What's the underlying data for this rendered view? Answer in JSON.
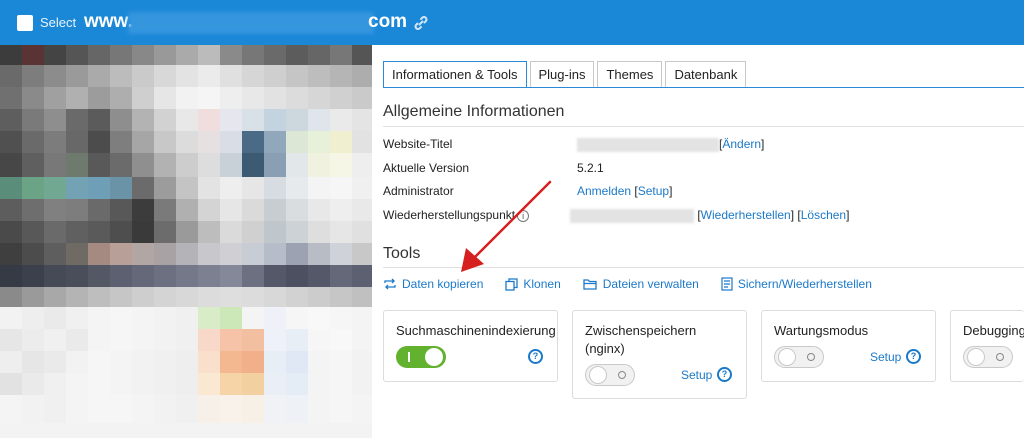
{
  "header": {
    "select_label": "Select",
    "domain_prefix": "www.",
    "domain_suffix": "com",
    "accent": "#1a87d7"
  },
  "tabs": [
    {
      "label": "Informationen & Tools",
      "active": true
    },
    {
      "label": "Plug-ins",
      "active": false
    },
    {
      "label": "Themes",
      "active": false
    },
    {
      "label": "Datenbank",
      "active": false
    }
  ],
  "general": {
    "title": "Allgemeine Informationen",
    "site_title_label": "Website-Titel",
    "site_title_change": "Ändern",
    "version_label": "Aktuelle Version",
    "version_value": "5.2.1",
    "admin_label": "Administrator",
    "admin_login": "Anmelden",
    "admin_setup": "Setup",
    "restore_label": "Wiederherstellungspunkt",
    "restore_action": "Wiederherstellen",
    "delete_action": "Löschen"
  },
  "tools": {
    "title": "Tools",
    "copy_data": "Daten kopieren",
    "clone": "Klonen",
    "manage_files": "Dateien verwalten",
    "backup_restore": "Sichern/Wiederherstellen"
  },
  "cards": {
    "indexing": {
      "title": "Suchmaschinenindexierung",
      "enabled": true
    },
    "caching": {
      "title_line1": "Zwischenspeichern",
      "title_line2": "(nginx)",
      "setup": "Setup",
      "enabled": false
    },
    "maintenance": {
      "title": "Wartungsmodus",
      "setup": "Setup",
      "enabled": false
    },
    "debugging": {
      "title": "Debugging",
      "enabled": false
    }
  },
  "icons": [
    "link-icon",
    "info-icon",
    "copy-data-icon",
    "clone-icon",
    "folder-icon",
    "backup-icon",
    "help-icon"
  ],
  "colors": {
    "link": "#1b79c9",
    "toggle_on": "#62b22f",
    "arrow": "#d62020"
  }
}
